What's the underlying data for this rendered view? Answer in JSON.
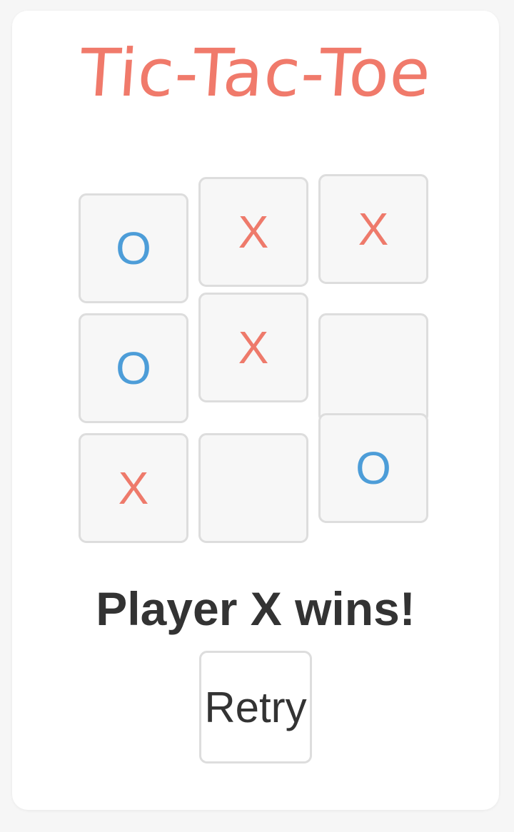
{
  "app": {
    "title": "Tic-Tac-Toe"
  },
  "board": {
    "cells": [
      {
        "row": 1,
        "col": 1,
        "mark": "O"
      },
      {
        "row": 1,
        "col": 2,
        "mark": "X"
      },
      {
        "row": 1,
        "col": 3,
        "mark": "X"
      },
      {
        "row": 2,
        "col": 1,
        "mark": "O"
      },
      {
        "row": 2,
        "col": 2,
        "mark": "X"
      },
      {
        "row": 2,
        "col": 3,
        "mark": ""
      },
      {
        "row": 3,
        "col": 1,
        "mark": "X"
      },
      {
        "row": 3,
        "col": 2,
        "mark": ""
      },
      {
        "row": 3,
        "col": 3,
        "mark": "O"
      }
    ]
  },
  "status": {
    "text": "Player X wins!"
  },
  "controls": {
    "retry_label": "Retry"
  },
  "colors": {
    "title": "#f07a6b",
    "x_mark": "#ee7a6b",
    "o_mark": "#4d9dd8",
    "status_text": "#333333",
    "cell_bg": "#f7f7f7",
    "cell_border": "#dddddd"
  }
}
